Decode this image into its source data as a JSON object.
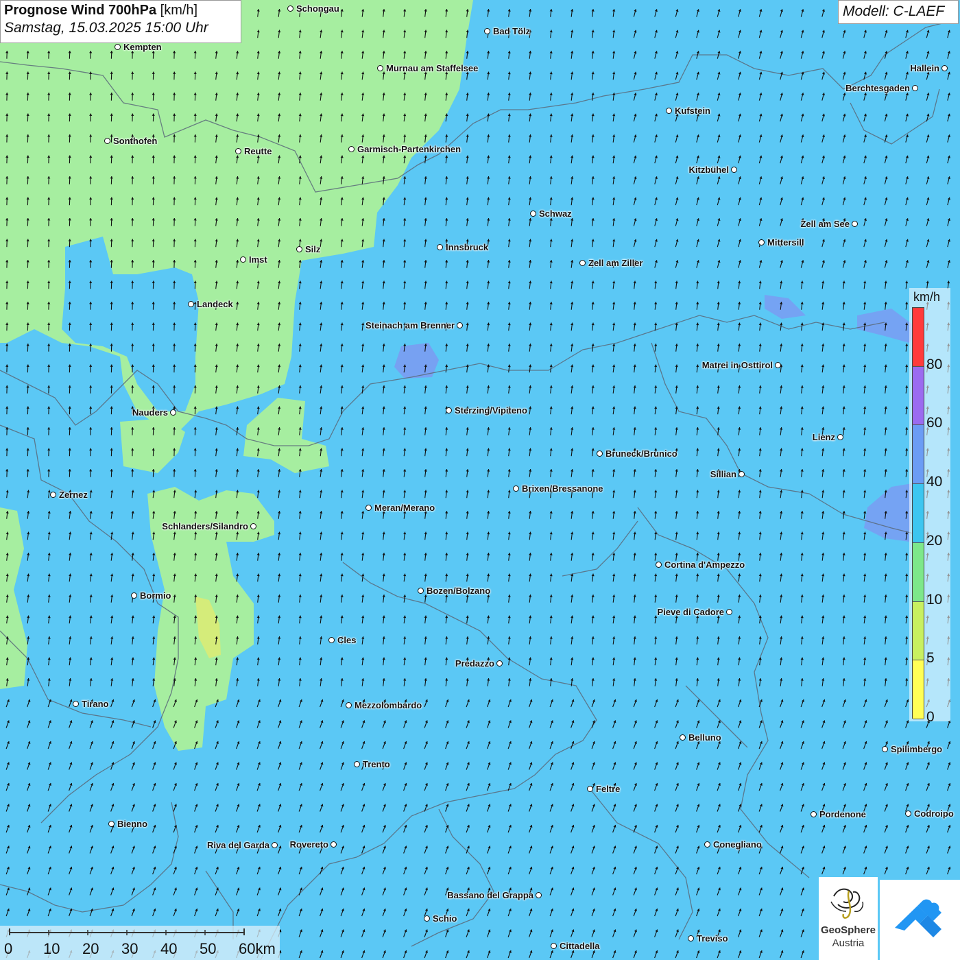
{
  "title": {
    "main_bold": "Prognose Wind 700hPa",
    "unit": "[km/h]",
    "datetime": "Samstag, 15.03.2025 15:00 Uhr"
  },
  "model": "Modell: C-LAEF",
  "legend": {
    "unit": "km/h",
    "labels": [
      "80",
      "60",
      "40",
      "20",
      "10",
      "5",
      "0"
    ],
    "colors": [
      "#ff3b3b",
      "#9b6bf0",
      "#6b9cf5",
      "#3cc6f0",
      "#7de88a",
      "#c8f060",
      "#ffff55"
    ]
  },
  "scalebar": {
    "labels": [
      "0",
      "10",
      "20",
      "30",
      "40",
      "50",
      "60km"
    ]
  },
  "logo": {
    "name": "GeoSphere",
    "sub": "Austria"
  },
  "wind_direction": "south-southwest, arrows pointing north",
  "cities": [
    {
      "name": "Schongau"
    },
    {
      "name": "Bad Tölz"
    },
    {
      "name": "Kempten"
    },
    {
      "name": "Murnau am Staffelsee"
    },
    {
      "name": "Hallein"
    },
    {
      "name": "Berchtesgaden"
    },
    {
      "name": "Kufstein"
    },
    {
      "name": "Sonthofen"
    },
    {
      "name": "Reutte"
    },
    {
      "name": "Garmisch-Partenkirchen"
    },
    {
      "name": "Kitzbühel"
    },
    {
      "name": "Schwaz"
    },
    {
      "name": "Zell am See"
    },
    {
      "name": "Mittersill"
    },
    {
      "name": "Innsbruck"
    },
    {
      "name": "Silz"
    },
    {
      "name": "Imst"
    },
    {
      "name": "Zell am Ziller"
    },
    {
      "name": "Landeck"
    },
    {
      "name": "Steinach am Brenner"
    },
    {
      "name": "Matrei in Osttirol"
    },
    {
      "name": "Nauders"
    },
    {
      "name": "Sterzing/Vipiteno"
    },
    {
      "name": "Lienz"
    },
    {
      "name": "Bruneck/Brunico"
    },
    {
      "name": "Sillian"
    },
    {
      "name": "Brixen/Bressanone"
    },
    {
      "name": "Zernez"
    },
    {
      "name": "Meran/Merano"
    },
    {
      "name": "Schlanders/Silandro"
    },
    {
      "name": "Cortina d'Ampezzo"
    },
    {
      "name": "Bozen/Bolzano"
    },
    {
      "name": "Bormio"
    },
    {
      "name": "Pieve di Cadore"
    },
    {
      "name": "Cles"
    },
    {
      "name": "Predazzo"
    },
    {
      "name": "Tirano"
    },
    {
      "name": "Mezzolombardo"
    },
    {
      "name": "Belluno"
    },
    {
      "name": "Spilimbergo"
    },
    {
      "name": "Trento"
    },
    {
      "name": "Feltre"
    },
    {
      "name": "Pordenone"
    },
    {
      "name": "Codroipo"
    },
    {
      "name": "Bienno"
    },
    {
      "name": "Riva del Garda"
    },
    {
      "name": "Rovereto"
    },
    {
      "name": "Conegliano"
    },
    {
      "name": "Bassano del Grappa"
    },
    {
      "name": "Schio"
    },
    {
      "name": "Treviso"
    },
    {
      "name": "Cittadella"
    }
  ]
}
